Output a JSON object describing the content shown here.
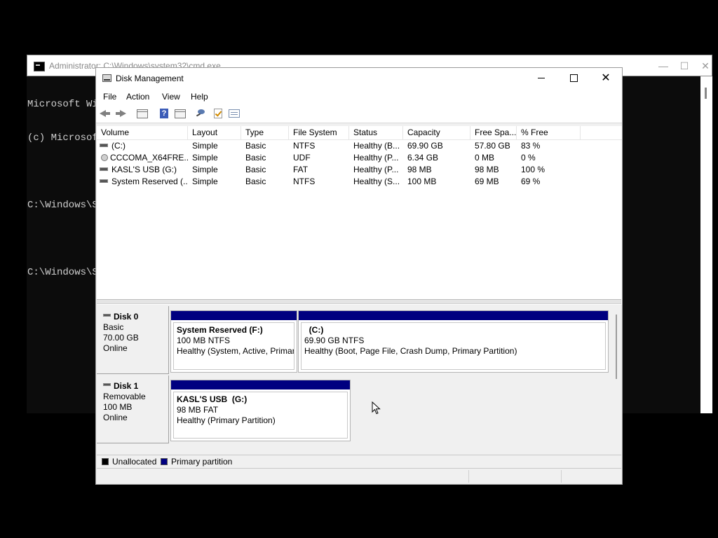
{
  "cmd_window": {
    "title": "Administrator: C:\\Windows\\system32\\cmd.exe",
    "lines": [
      "Microsoft Wi",
      "(c) Microsof",
      "",
      "C:\\Windows\\S",
      "",
      "C:\\Windows\\S"
    ],
    "minimize_symbol": "—",
    "maximize_symbol": "☐",
    "close_symbol": "✕"
  },
  "disk_management": {
    "title": "Disk Management",
    "close_symbol": "✕",
    "menu": [
      "File",
      "Action",
      "View",
      "Help"
    ],
    "toolbar_icons": [
      "back-icon",
      "forward-icon",
      "disk-list-icon",
      "help-icon",
      "console-view-icon",
      "rescan-icon",
      "check-icon",
      "properties-icon"
    ],
    "columns": [
      "Volume",
      "Layout",
      "Type",
      "File System",
      "Status",
      "Capacity",
      "Free Spa...",
      "% Free"
    ],
    "volumes": [
      {
        "volume": "(C:)",
        "layout": "Simple",
        "type": "Basic",
        "fs": "NTFS",
        "status": "Healthy (B...",
        "capacity": "69.90 GB",
        "free": "57.80 GB",
        "pct": "83 %",
        "icon": "drive-icon"
      },
      {
        "volume": "CCCOMA_X64FRE...",
        "layout": "Simple",
        "type": "Basic",
        "fs": "UDF",
        "status": "Healthy (P...",
        "capacity": "6.34 GB",
        "free": "0 MB",
        "pct": "0 %",
        "icon": "disc-icon"
      },
      {
        "volume": "KASL'S USB (G:)",
        "layout": "Simple",
        "type": "Basic",
        "fs": "FAT",
        "status": "Healthy (P...",
        "capacity": "98 MB",
        "free": "98 MB",
        "pct": "100 %",
        "icon": "drive-icon"
      },
      {
        "volume": "System Reserved (...",
        "layout": "Simple",
        "type": "Basic",
        "fs": "NTFS",
        "status": "Healthy (S...",
        "capacity": "100 MB",
        "free": "69 MB",
        "pct": "69 %",
        "icon": "drive-icon"
      }
    ],
    "disks": [
      {
        "name": "Disk 0",
        "kind": "Basic",
        "size": "70.00 GB",
        "state": "Online",
        "partitions": [
          {
            "name": "System Reserved  (F:)",
            "size_fs": "100 MB NTFS",
            "health": "Healthy (System, Active, Primar"
          },
          {
            "name": "  (C:)",
            "size_fs": "69.90 GB NTFS",
            "health": "Healthy (Boot, Page File, Crash Dump, Primary Partition)"
          }
        ]
      },
      {
        "name": "Disk 1",
        "kind": "Removable",
        "size": "100 MB",
        "state": "Online",
        "partitions": [
          {
            "name": "KASL'S USB  (G:)",
            "size_fs": "98 MB FAT",
            "health": "Healthy (Primary Partition)"
          }
        ]
      }
    ],
    "legend": [
      {
        "label": "Unallocated",
        "color": "#000000"
      },
      {
        "label": "Primary partition",
        "color": "#000080"
      }
    ]
  }
}
